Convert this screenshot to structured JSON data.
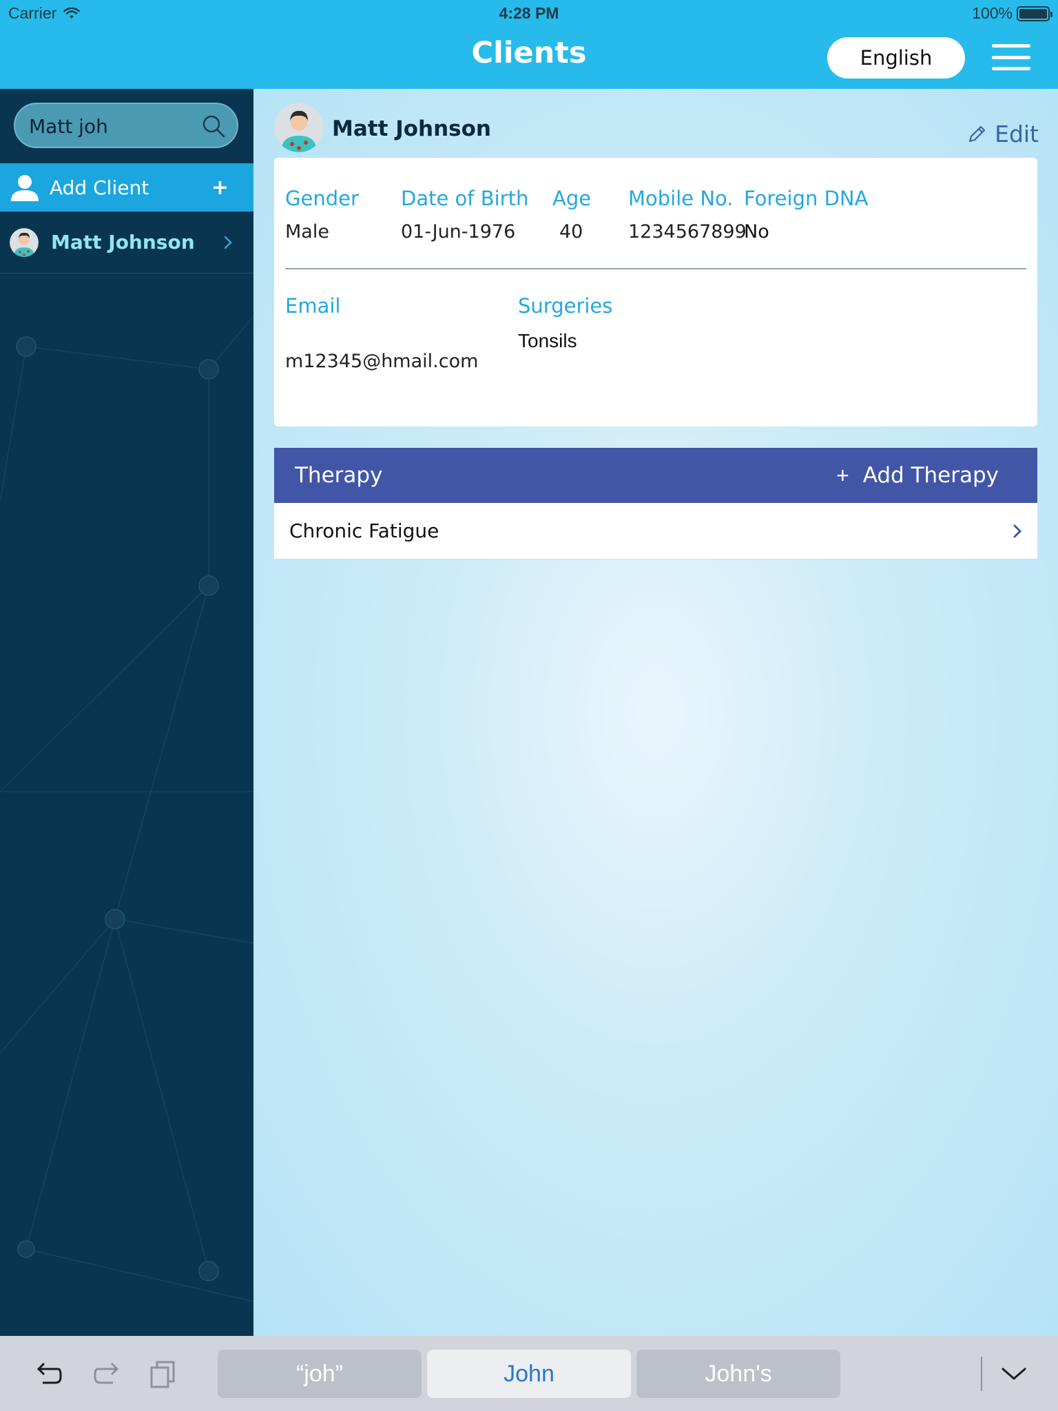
{
  "status_bar": {
    "carrier": "Carrier",
    "time": "4:28 PM",
    "battery": "100%"
  },
  "header": {
    "title": "Clients",
    "language_button": "English",
    "menu_icon": "hamburger-menu-icon"
  },
  "sidebar": {
    "search_value": "Matt joh",
    "search_icon": "search-icon",
    "add_client_label": "Add Client",
    "add_client_plus": "+",
    "clients": [
      {
        "name": "Matt Johnson"
      }
    ]
  },
  "profile": {
    "name": "Matt Johnson",
    "edit_label": "Edit",
    "fields": {
      "gender_label": "Gender",
      "gender_value": "Male",
      "dob_label": "Date of Birth",
      "dob_value": "01-Jun-1976",
      "age_label": "Age",
      "age_value": "40",
      "mobile_label": "Mobile No.",
      "mobile_value": "1234567899",
      "foreign_dna_label": "Foreign DNA",
      "foreign_dna_value": "No",
      "email_label": "Email",
      "email_value": "m12345@hmail.com",
      "surgeries_label": "Surgeries",
      "surgeries_value": "Tonsils"
    }
  },
  "therapy": {
    "title": "Therapy",
    "add_plus": "+",
    "add_label": "Add Therapy",
    "items": [
      {
        "label": "Chronic Fatigue"
      }
    ]
  },
  "keyboard": {
    "suggestions": [
      "“joh”",
      "John",
      "John's"
    ],
    "tools": [
      "undo-icon",
      "redo-icon",
      "paste-icon"
    ],
    "dismiss_icon": "keyboard-dismiss-icon"
  },
  "colors": {
    "header_bg": "#26bbeb",
    "sidebar_bg": "#0a3550",
    "accent": "#1ba6e0",
    "label_blue": "#23a8e0",
    "therapy_bar": "#4256a8"
  }
}
